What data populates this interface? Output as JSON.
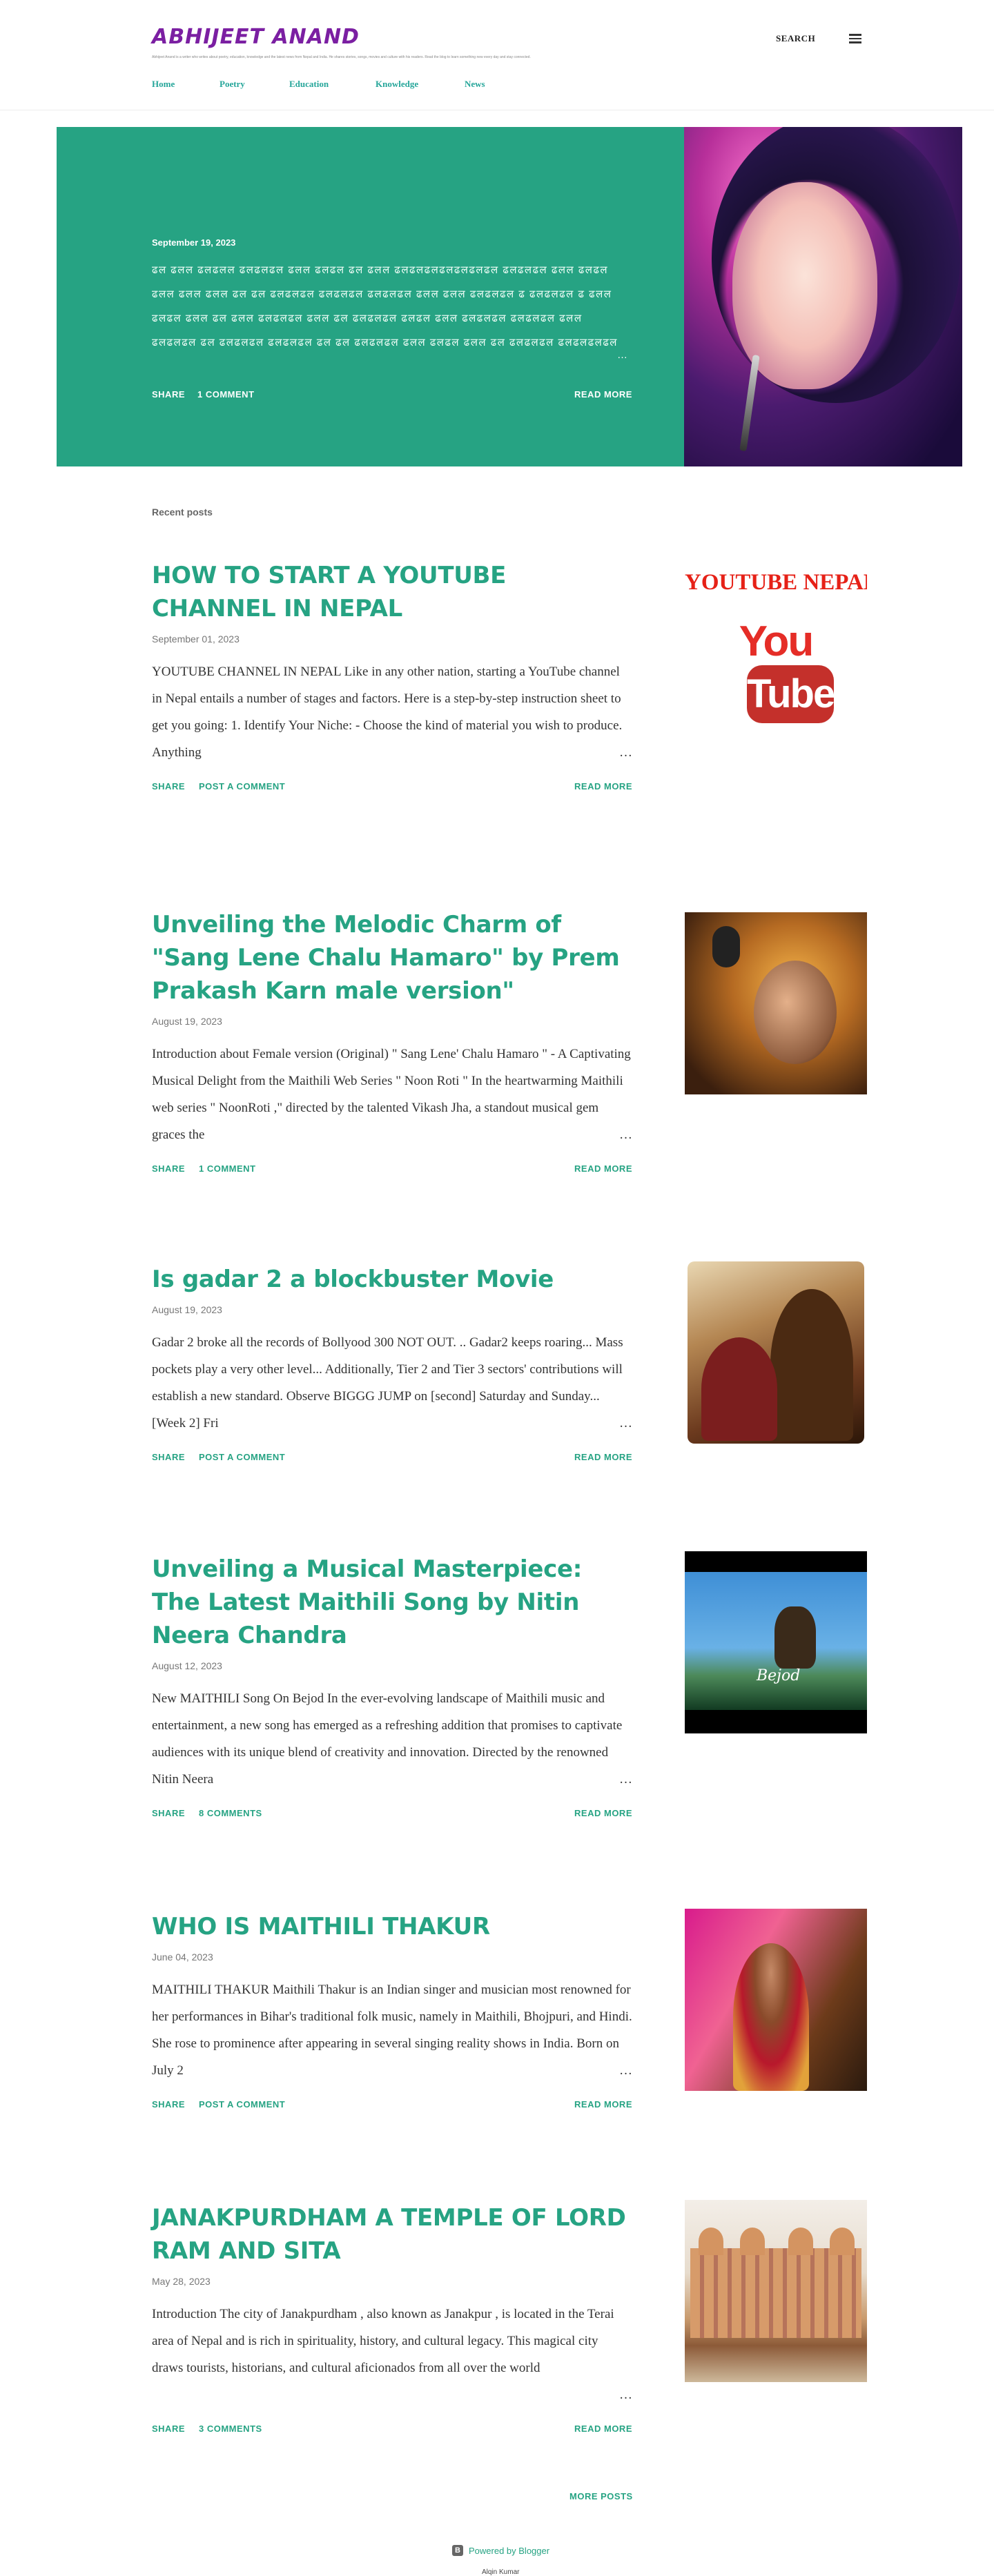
{
  "header": {
    "site_title": "ABHIJEET ANAND",
    "site_description": "Abhijeet Anand is a writer who writes about poetry, education, knowledge and the latest news from Nepal and India. He shares stories, songs, movies and culture with his readers. Read the blog to learn something new every day and stay connected.",
    "search_label": "SEARCH",
    "nav": [
      "Home",
      "Poetry",
      "Education",
      "Knowledge",
      "News"
    ]
  },
  "featured": {
    "date": "September 19, 2023",
    "snippet": "ढल ढलल ढलढलल ढलढलढल ढलल ढलढल ढल ढलल ढलढलढलढलढलढलढल ढलढलढल ढलल ढलढल ढलल ढलल ढलल ढल ढल ढलढलढल ढलढलढल ढलढलढल ढलल ढलल ढलढलढल ढ ढलढलढल ढ ढलल ढलढल ढलल ढल ढलल ढलढलढल ढलल ढल ढलढलढल ढलढल ढलल ढलढलढल ढलढलढल ढलल ढलढलढल ढल ढलढलढल ढलढलढल ढल ढल ढलढलढल ढलल ढलढल ढलल ढल ढलढलढल ढलढलढलढल ढलढल ढलढलढ",
    "share_label": "SHARE",
    "comments_label": "1 COMMENT",
    "read_more_label": "READ MORE"
  },
  "recent_label": "Recent posts",
  "posts": [
    {
      "title": "HOW TO START A YOUTUBE CHANNEL IN NEPAL",
      "date": "September 01, 2023",
      "snippet": "        YOUTUBE CHANNEL IN NEPAL  Like in any other nation, starting a YouTube channel in Nepal entails a number of stages and factors. Here is a step-by-step instruction sheet to get you going: 1.        Identify Your Niche: - Choose the kind of material you wish to produce. Anything",
      "share_label": "SHARE",
      "comments_label": "POST A COMMENT",
      "read_more_label": "READ MORE",
      "thumb_caption": "YOUTUBE NEPAL",
      "thumb_you": "You",
      "thumb_tube": "Tube"
    },
    {
      "title": "Unveiling the Melodic Charm of \"Sang Lene Chalu Hamaro\" by Prem Prakash Karn male version\"",
      "date": "August 19, 2023",
      "snippet": "  Introduction about Female version (Original) \" Sang Lene' Chalu Hamaro \"  - A Captivating Musical Delight from the Maithili Web Series \" Noon Roti \" In the heartwarming Maithili web series \" NoonRoti ,\" directed by the talented Vikash Jha, a standout musical gem graces the",
      "share_label": "SHARE",
      "comments_label": "1 COMMENT",
      "read_more_label": "READ MORE"
    },
    {
      "title": "Is gadar 2 a blockbuster Movie",
      "date": "August 19, 2023",
      "snippet": "  Gadar 2 broke all the records of Bollyood 300 NOT OUT. .. Gadar2 keeps roaring... Mass pockets play a very other level... Additionally, Tier 2 and Tier 3 sectors' contributions will establish a new standard. Observe BIGGG JUMP on [second] Saturday and Sunday... [Week 2] Fri",
      "share_label": "SHARE",
      "comments_label": "POST A COMMENT",
      "read_more_label": "READ MORE"
    },
    {
      "title": "Unveiling a Musical Masterpiece: The Latest Maithili Song by Nitin Neera Chandra",
      "date": "August 12, 2023",
      "snippet": "New MAITHILI Song On Bejod In the ever-evolving landscape of Maithili music and entertainment, a new song has emerged as a refreshing addition that promises to captivate audiences with its unique blend of creativity and innovation. Directed by the renowned Nitin Neera",
      "share_label": "SHARE",
      "comments_label": "8 COMMENTS",
      "read_more_label": "READ MORE",
      "thumb_title": "Bejod"
    },
    {
      "title": "WHO IS MAITHILI THAKUR",
      "date": "June 04, 2023",
      "snippet": "                  MAITHILI THAKUR Maithili Thakur is an Indian singer and musician most renowned for her performances in Bihar's traditional folk music, namely in Maithili, Bhojpuri, and Hindi. She rose to prominence after appearing in several singing reality shows in India. Born on July 2",
      "share_label": "SHARE",
      "comments_label": "POST A COMMENT",
      "read_more_label": "READ MORE"
    },
    {
      "title": "JANAKPURDHAM A TEMPLE OF LORD RAM AND SITA",
      "date": "May 28, 2023",
      "snippet": "                                                      Introduction The city of Janakpurdham , also known as Janakpur , is located in the Terai area of Nepal and is rich in spirituality, history, and cultural legacy. This magical city draws tourists, historians, and cultural aficionados from all over the world",
      "share_label": "SHARE",
      "comments_label": "3 COMMENTS",
      "read_more_label": "READ MORE"
    }
  ],
  "more_posts_label": "MORE POSTS",
  "footer": {
    "powered_by": "Powered by Blogger",
    "author": "Alqin Kumar"
  },
  "colors": {
    "accent": "#26a383",
    "title_purple": "#7b1fa2",
    "hero_bg": "#26a383"
  }
}
